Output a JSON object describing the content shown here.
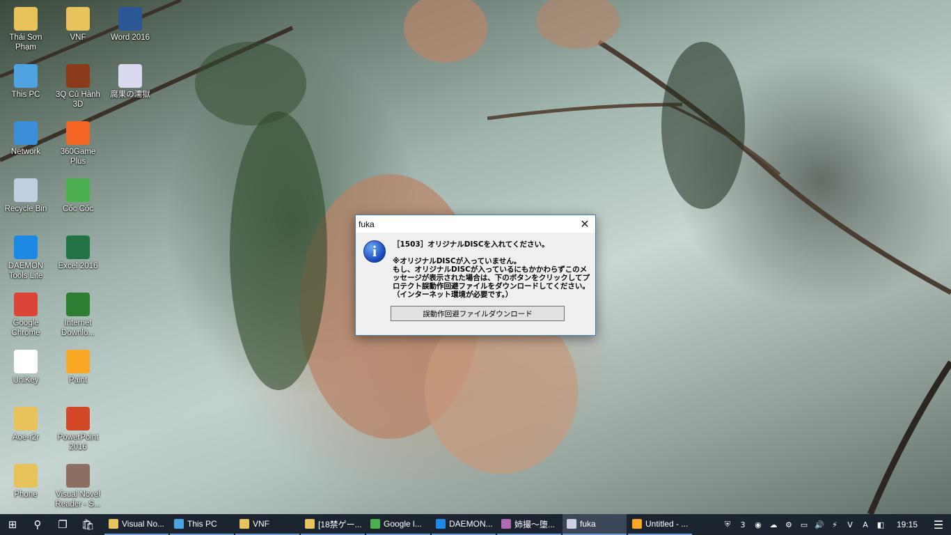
{
  "desktop": {
    "icons": [
      {
        "label": "Thái Sơn Phạm",
        "icon": "user-folder-icon",
        "color": "#e8c25a"
      },
      {
        "label": "VNF",
        "icon": "folder-icon",
        "color": "#e8c25a"
      },
      {
        "label": "Word 2016",
        "icon": "word-icon",
        "color": "#2b5797"
      },
      {
        "label": "This PC",
        "icon": "computer-icon",
        "color": "#4fa3e0"
      },
      {
        "label": "3Q Củ Hành 3D",
        "icon": "game-icon",
        "color": "#8b3a1a"
      },
      {
        "label": "腐果の濡獄",
        "icon": "syringe-icon",
        "color": "#d9d9f0"
      },
      {
        "label": "Network",
        "icon": "network-icon",
        "color": "#3a8fd8"
      },
      {
        "label": "360Game Plus",
        "icon": "360game-icon",
        "color": "#f26522"
      },
      {
        "label": "Recycle Bin",
        "icon": "recycle-bin-icon",
        "color": "#c0d0e0"
      },
      {
        "label": "Cốc Cốc",
        "icon": "coccoc-icon",
        "color": "#4caf50"
      },
      {
        "label": "DAEMON Tools Lite",
        "icon": "daemon-tools-icon",
        "color": "#1e88e5"
      },
      {
        "label": "Excel 2016",
        "icon": "excel-icon",
        "color": "#217346"
      },
      {
        "label": "Google Chrome",
        "icon": "chrome-icon",
        "color": "#db4437"
      },
      {
        "label": "Internet Downlo...",
        "icon": "idm-icon",
        "color": "#2e7d32"
      },
      {
        "label": "UniKey",
        "icon": "unikey-icon",
        "color": "#ffffff"
      },
      {
        "label": "Paint",
        "icon": "paint-icon",
        "color": "#f9a825"
      },
      {
        "label": "Aoe-r2r",
        "icon": "folder-icon",
        "color": "#e8c25a"
      },
      {
        "label": "PowerPoint 2016",
        "icon": "powerpoint-icon",
        "color": "#d24726"
      },
      {
        "label": "Phone",
        "icon": "folder-icon",
        "color": "#e8c25a"
      },
      {
        "label": "Visual Novel Reader - S...",
        "icon": "vnr-icon",
        "color": "#8d6e63"
      }
    ]
  },
  "dialog": {
    "title": "fuka",
    "close": "✕",
    "icon_glyph": "i",
    "message_line1": "［1503］オリジナルDISCを入れてください。",
    "message_line2": "※オリジナルDISCが入っていません。",
    "message_line3": "もし、オリジナルDISCが入っているにもかかわらずこのメッセージが表示された場合は、下のボタンをクリックしてプロテクト誤動作回避ファイルをダウンロードしてください。",
    "message_line4": "（インターネット環境が必要です。）",
    "button_label": "誤動作回避ファイルダウンロード"
  },
  "taskbar": {
    "start": "⊞",
    "search": "⚲",
    "taskview": "❐",
    "store": "🛍",
    "apps": [
      {
        "label": "Visual No...",
        "color": "#e8c25a",
        "active": false
      },
      {
        "label": "This PC",
        "color": "#4fa3e0",
        "active": false
      },
      {
        "label": "VNF",
        "color": "#e8c25a",
        "active": false
      },
      {
        "label": "[18禁ゲー...",
        "color": "#e8c25a",
        "active": false
      },
      {
        "label": "Google l...",
        "color": "#4caf50",
        "active": false
      },
      {
        "label": "DAEMON...",
        "color": "#1e88e5",
        "active": false
      },
      {
        "label": "姉撮〜堕...",
        "color": "#b06ab3",
        "active": false
      },
      {
        "label": "fuka",
        "color": "#cfcfe8",
        "active": true
      },
      {
        "label": "Untitled - ...",
        "color": "#f9a825",
        "active": false
      }
    ],
    "tray": [
      "⛨",
      "3",
      "◉",
      "☁",
      "⚙",
      "▭",
      "🔊",
      "⚡",
      "V",
      "A",
      "◧"
    ],
    "clock": "19:15",
    "notification": "☰"
  }
}
